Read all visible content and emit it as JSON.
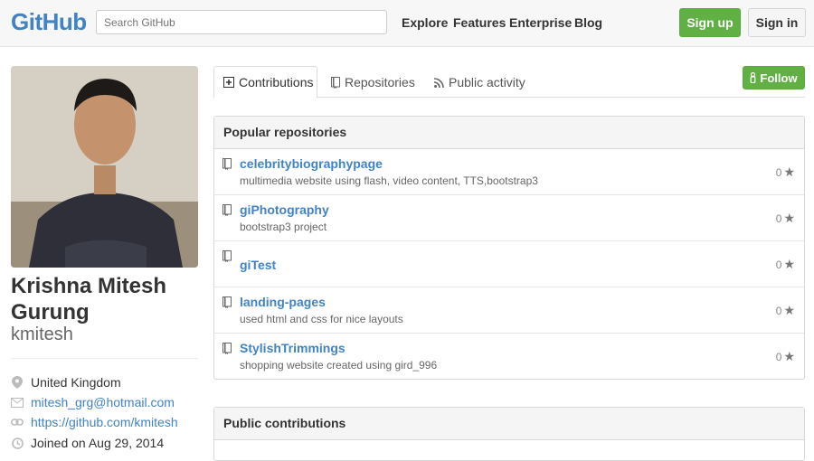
{
  "header": {
    "logo": "GitHub",
    "search_placeholder": "Search GitHub",
    "nav": [
      "Explore",
      "Features",
      "Enterprise",
      "Blog"
    ],
    "signup_label": "Sign up",
    "signin_label": "Sign in"
  },
  "profile": {
    "fullname": "Krishna Mitesh Gurung",
    "username": "kmitesh",
    "location": "United Kingdom",
    "email": "mitesh_grg@hotmail.com",
    "website": "https://github.com/kmitesh",
    "joined": "Joined on Aug 29, 2014"
  },
  "tabs": [
    {
      "label": "Contributions",
      "icon": "plus-square-icon"
    },
    {
      "label": "Repositories",
      "icon": "repo-icon"
    },
    {
      "label": "Public activity",
      "icon": "rss-icon"
    }
  ],
  "follow_label": "Follow",
  "popular": {
    "title": "Popular repositories",
    "repos": [
      {
        "name": "celebritybiographypage",
        "desc": "multimedia website using flash, video content, TTS,bootstrap3",
        "stars": "0"
      },
      {
        "name": "giPhotography",
        "desc": "bootstrap3 project",
        "stars": "0"
      },
      {
        "name": "giTest",
        "desc": "",
        "stars": "0"
      },
      {
        "name": "landing-pages",
        "desc": "used html and css for nice layouts",
        "stars": "0"
      },
      {
        "name": "StylishTrimmings",
        "desc": "shopping website created using gird_996",
        "stars": "0"
      }
    ]
  },
  "public_contributions": {
    "title": "Public contributions"
  },
  "colors": {
    "link": "#4183c4",
    "green": "#60b044"
  }
}
